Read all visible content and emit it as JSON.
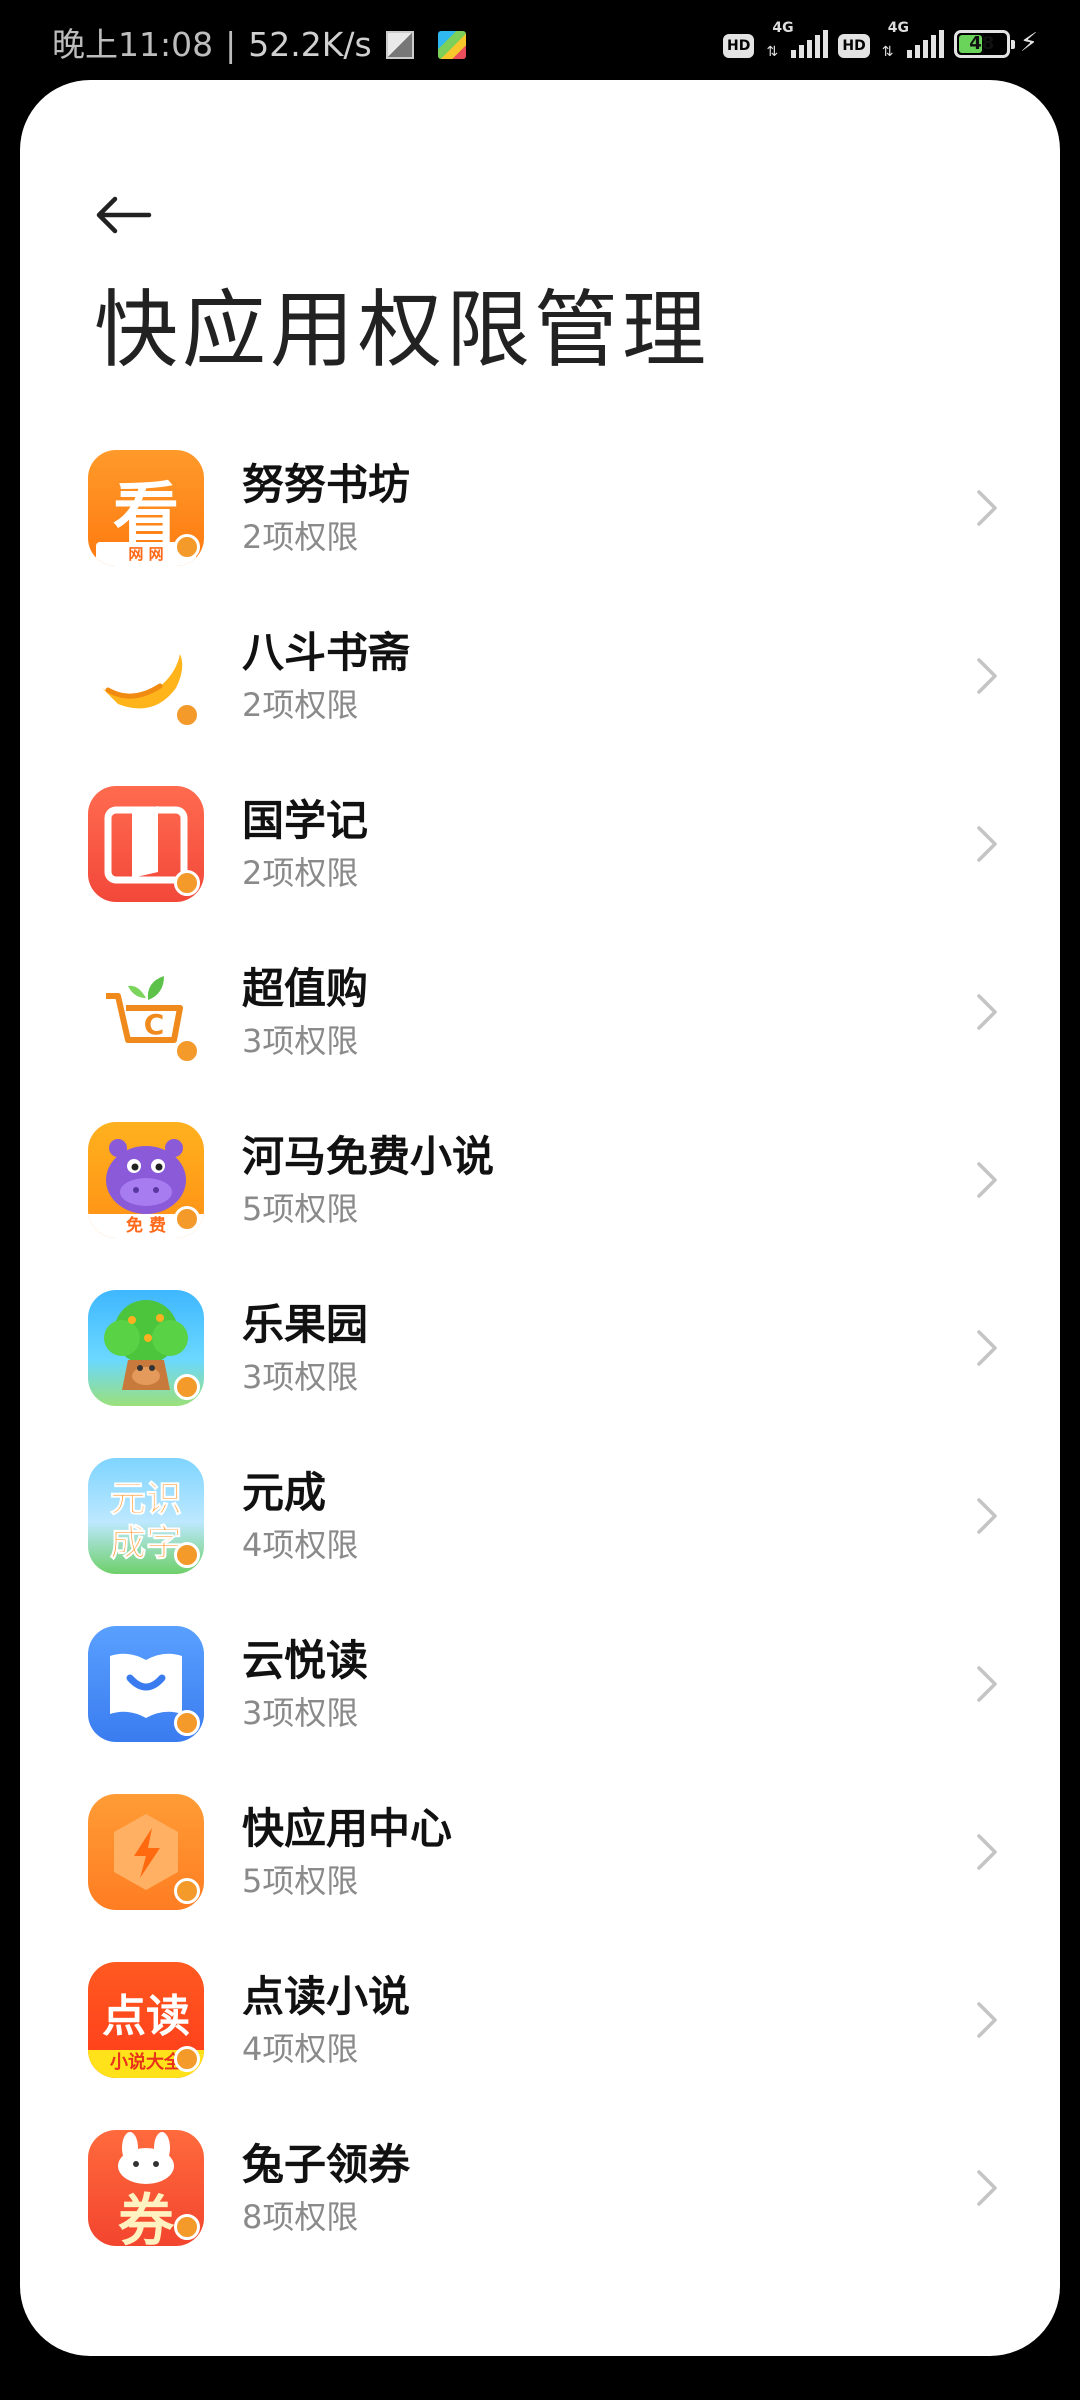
{
  "status_bar": {
    "time": "晚上11:08",
    "separator": "|",
    "speed": "52.2K/s",
    "net1": "4G",
    "net2": "4G",
    "hd1": "HD",
    "hd2": "HD",
    "battery": "48"
  },
  "page": {
    "title": "快应用权限管理",
    "back_icon": "arrow-left-icon"
  },
  "apps": [
    {
      "name": "努努书坊",
      "permissions": "2项权限",
      "icon_text": "看",
      "icon_sub": "网 网"
    },
    {
      "name": "八斗书斋",
      "permissions": "2项权限"
    },
    {
      "name": "国学记",
      "permissions": "2项权限"
    },
    {
      "name": "超值购",
      "permissions": "3项权限",
      "icon_text": "C"
    },
    {
      "name": "河马免费小说",
      "permissions": "5项权限",
      "icon_sub": "免 费"
    },
    {
      "name": "乐果园",
      "permissions": "3项权限"
    },
    {
      "name": "元成",
      "permissions": "4项权限",
      "icon_text": "元识",
      "icon_sub": "成字"
    },
    {
      "name": "云悦读",
      "permissions": "3项权限"
    },
    {
      "name": "快应用中心",
      "permissions": "5项权限"
    },
    {
      "name": "点读小说",
      "permissions": "4项权限",
      "icon_text": "点读",
      "icon_sub": "小说大全"
    },
    {
      "name": "兔子领券",
      "permissions": "8项权限",
      "icon_text": "券"
    }
  ],
  "colors": {
    "accent_badge": "#f39a2b",
    "secondary_text": "#8a8a8a",
    "chevron": "#c4c4c4"
  }
}
